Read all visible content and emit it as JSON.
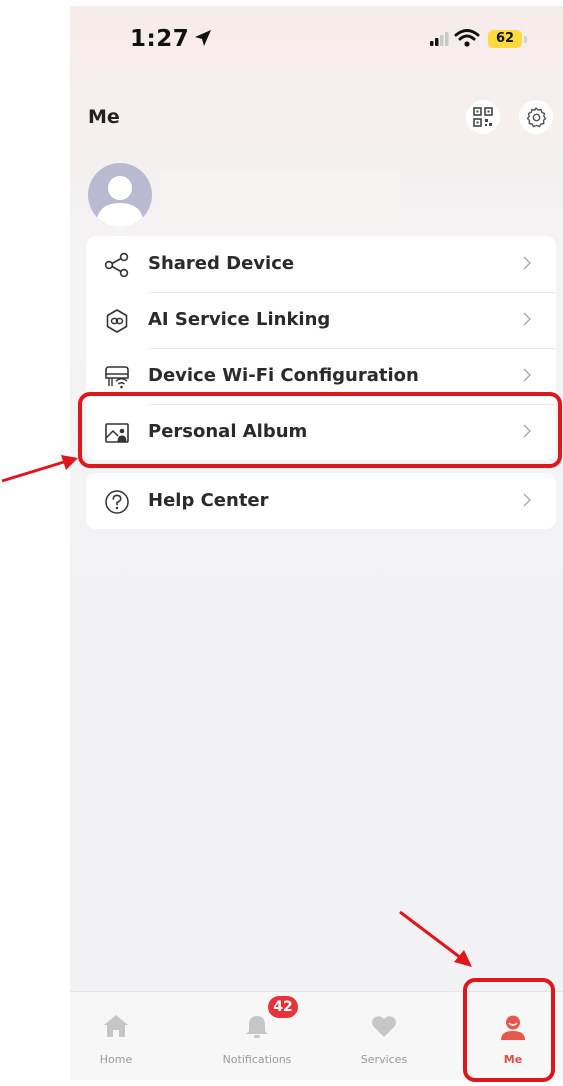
{
  "status_bar": {
    "time": "1:27",
    "battery": "62"
  },
  "header": {
    "title": "Me",
    "icons": [
      "qr-code-icon",
      "gear-icon"
    ]
  },
  "profile": {
    "avatar_icon": "user-avatar-icon",
    "name": ""
  },
  "menu": {
    "group1": [
      {
        "label": "Shared Device",
        "icon": "share-icon"
      },
      {
        "label": "AI Service Linking",
        "icon": "link-icon"
      },
      {
        "label": "Device Wi-Fi Configuration",
        "icon": "router-wifi-icon"
      },
      {
        "label": "Personal Album",
        "icon": "photo-album-icon"
      }
    ],
    "group2": [
      {
        "label": "Help Center",
        "icon": "help-circle-icon"
      }
    ]
  },
  "tab_bar": {
    "tabs": [
      {
        "label": "Home",
        "icon": "home-icon"
      },
      {
        "label": "Notifications",
        "icon": "bell-icon",
        "badge": "42"
      },
      {
        "label": "Services",
        "icon": "heart-icon"
      },
      {
        "label": "Me",
        "icon": "person-icon",
        "active": true
      }
    ]
  },
  "colors": {
    "accent": "#e04e44",
    "annotation": "#e0161d",
    "badge": "#e8323a"
  }
}
